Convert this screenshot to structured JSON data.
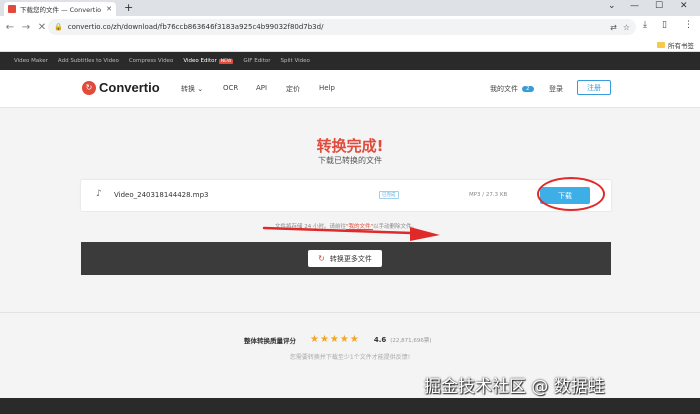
{
  "browser": {
    "tab_title": "下载您的文件 — Convertio",
    "url": "convertio.co/zh/download/fb76ccb863646f3183a925c4b99032f80d7b3d/",
    "bookmarks_other": "所有书签"
  },
  "tools_strip": {
    "items": [
      "Video Maker",
      "Add Subtitles to Video",
      "Compress Video",
      "Video Editor",
      "GIF Editor",
      "Split Video"
    ],
    "new_badge": "NEW"
  },
  "nav": {
    "logo": "Convertio",
    "convert": "转换",
    "ocr": "OCR",
    "api": "API",
    "pricing": "定价",
    "help": "Help",
    "my_files": "我的文件",
    "files_count": "2",
    "login": "登录",
    "register": "注册"
  },
  "content": {
    "heading": "转换完成!",
    "subheading": "下载已转换的文件",
    "file": {
      "name": "Video_240318144428.mp3",
      "status": "已完成",
      "info": "MP3 / 27.3 KB",
      "download": "下载"
    },
    "notice_before": "文件将存储 24 小时。请前往",
    "notice_link": "\"我的文件\"",
    "notice_after": "以手动删除文件。",
    "more_button": "转换更多文件"
  },
  "rating": {
    "label": "整体转换质量评分",
    "stars": "★★★★★",
    "score": "4.6",
    "votes": "(22,871,696票)",
    "hint": "您需要转换并下载至少1个文件才能提供反馈!"
  },
  "watermark": "掘金技术社区 @ 数据蛙"
}
